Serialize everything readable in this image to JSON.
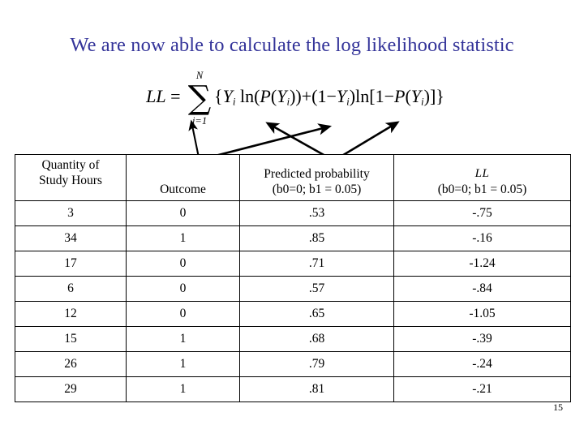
{
  "slide": {
    "title": "We are now able to calculate the log likelihood statistic",
    "title_color": "#333399",
    "page_number": "15"
  },
  "formula": {
    "lhs": "LL",
    "equals": "=",
    "sum_symbol": "∑",
    "sum_upper": "N",
    "sum_lower": "i=1",
    "expression_plain": "LL = ∑(i=1..N) {Yi ln(P(Yi)) + (1 − Yi) ln[1 − P(Yi)]}",
    "parts": {
      "open_brace": "{",
      "y_var": "Y",
      "sub_i": "i",
      "ln": "ln",
      "open_paren": "(",
      "p_var": "P",
      "close_paren": ")",
      "plus": "+",
      "one": "1",
      "minus": "−",
      "open_bracket": "[",
      "close_bracket": "]",
      "close_brace": "}"
    }
  },
  "annotations": {
    "arrow_count": 4,
    "description": "Four pointer arrows from the table header area up to terms of the log-likelihood formula"
  },
  "table": {
    "headers": [
      "Quantity of\nStudy Hours",
      "Outcome",
      "Predicted probability\n(b0=0; b1 = 0.05)",
      "LL\n(b0=0; b1 = 0.05)"
    ],
    "header_cells": [
      {
        "line1": "Quantity of",
        "line2": "Study Hours",
        "align": "top"
      },
      {
        "line1": "Outcome",
        "line2": "",
        "align": "bottom"
      },
      {
        "line1": "Predicted probability",
        "line2": "(b0=0; b1 = 0.05)",
        "align": "bottom"
      },
      {
        "line1": "LL",
        "line2": "(b0=0; b1 = 0.05)",
        "align": "bottom",
        "italic_first": true
      }
    ],
    "rows": [
      {
        "hours": "3",
        "outcome": "0",
        "predicted": ".53",
        "ll": "-.75"
      },
      {
        "hours": "34",
        "outcome": "1",
        "predicted": ".85",
        "ll": "-.16"
      },
      {
        "hours": "17",
        "outcome": "0",
        "predicted": ".71",
        "ll": "-1.24"
      },
      {
        "hours": "6",
        "outcome": "0",
        "predicted": ".57",
        "ll": "-.84"
      },
      {
        "hours": "12",
        "outcome": "0",
        "predicted": ".65",
        "ll": "-1.05"
      },
      {
        "hours": "15",
        "outcome": "1",
        "predicted": ".68",
        "ll": "-.39"
      },
      {
        "hours": "26",
        "outcome": "1",
        "predicted": ".79",
        "ll": "-.24"
      },
      {
        "hours": "29",
        "outcome": "1",
        "predicted": ".81",
        "ll": "-.21"
      }
    ]
  },
  "chart_data": {
    "type": "table",
    "title": "We are now able to calculate the log likelihood statistic",
    "columns": [
      "Quantity of Study Hours",
      "Outcome",
      "Predicted probability (b0=0; b1 = 0.05)",
      "LL (b0=0; b1 = 0.05)"
    ],
    "rows": [
      [
        "3",
        "0",
        ".53",
        "-.75"
      ],
      [
        "34",
        "1",
        ".85",
        "-.16"
      ],
      [
        "17",
        "0",
        ".71",
        "-1.24"
      ],
      [
        "6",
        "0",
        ".57",
        "-.84"
      ],
      [
        "12",
        "0",
        ".65",
        "-1.05"
      ],
      [
        "15",
        "1",
        ".68",
        "-.39"
      ],
      [
        "26",
        "1",
        ".79",
        "-.24"
      ],
      [
        "29",
        "1",
        ".81",
        "-.21"
      ]
    ],
    "study_hours": [
      3,
      34,
      17,
      6,
      12,
      15,
      26,
      29
    ],
    "outcome": [
      0,
      1,
      0,
      0,
      0,
      1,
      1,
      1
    ],
    "predicted_probability": [
      0.53,
      0.85,
      0.71,
      0.57,
      0.65,
      0.68,
      0.79,
      0.81
    ],
    "log_likelihood": [
      -0.75,
      -0.16,
      -1.24,
      -0.84,
      -1.05,
      -0.39,
      -0.24,
      -0.21
    ],
    "model_parameters": {
      "b0": 0,
      "b1": 0.05
    }
  }
}
